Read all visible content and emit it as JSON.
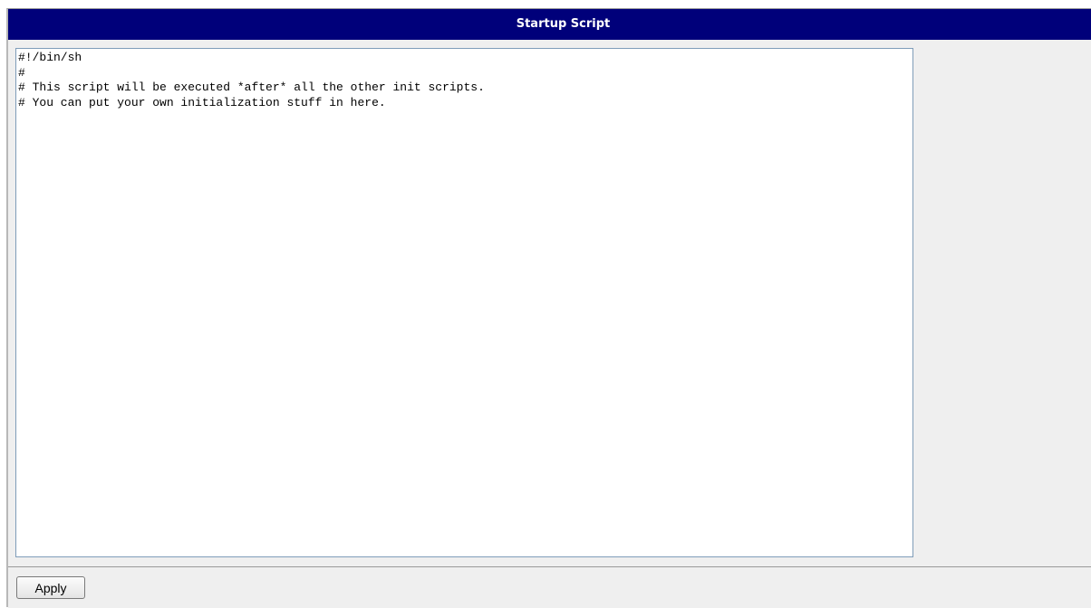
{
  "header": {
    "title": "Startup Script"
  },
  "editor": {
    "value": "#!/bin/sh\n#\n# This script will be executed *after* all the other init scripts.\n# You can put your own initialization stuff in here.\n"
  },
  "footer": {
    "apply_label": "Apply"
  },
  "colors": {
    "title_bar": "#00007a",
    "panel_background": "#efefef",
    "editor_border": "#7f9db9"
  }
}
